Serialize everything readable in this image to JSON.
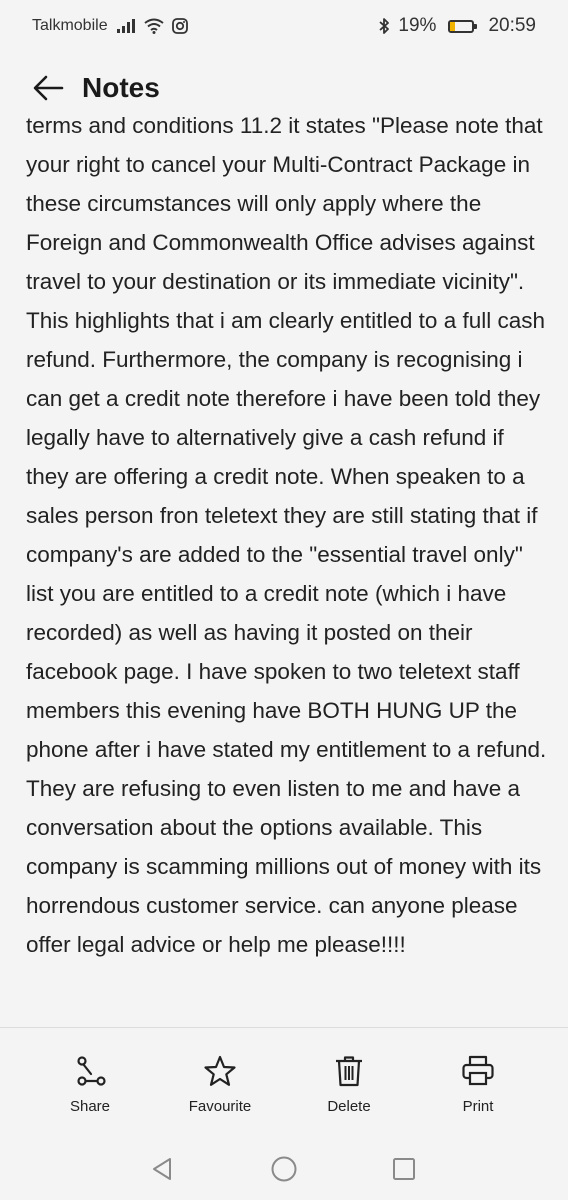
{
  "status_bar": {
    "carrier": "Talkmobile",
    "battery_percent": "19%",
    "battery_level": 0.19,
    "time": "20:59"
  },
  "header": {
    "title": "Notes"
  },
  "note": {
    "text": "terms and conditions 11.2 it states \"Please note that your right to cancel your Multi-Contract Package in these circumstances will only apply where the Foreign and Commonwealth Office advises against travel to your destination or its immediate vicinity\". This highlights that i am clearly entitled to a full cash refund. Furthermore, the company is recognising i can get a credit note therefore i have been told they legally have to alternatively give a cash refund if they are offering a credit note. When speaken to a sales person fron teletext they are still stating that if company's are added to the \"essential travel only\" list you are entitled to a credit note (which i have recorded) as well as having it posted on their facebook page. I have spoken to two teletext staff members this evening have BOTH HUNG UP the phone after i have stated my entitlement to a refund. They are refusing to even listen to me and have a conversation about the options available. This company is scamming millions out of money with its horrendous customer service. can anyone please offer legal advice or help me please!!!!"
  },
  "toolbar": {
    "share_label": "Share",
    "favourite_label": "Favourite",
    "delete_label": "Delete",
    "print_label": "Print"
  },
  "icons": {
    "back": "arrow-left-icon",
    "share": "share-icon",
    "favourite": "star-icon",
    "delete": "trash-icon",
    "print": "printer-icon",
    "nav_back": "triangle-back-icon",
    "nav_home": "circle-home-icon",
    "nav_recents": "square-recents-icon"
  },
  "colors": {
    "background": "#f4f4f4",
    "text": "#222222",
    "battery_fill": "#f0b400"
  }
}
